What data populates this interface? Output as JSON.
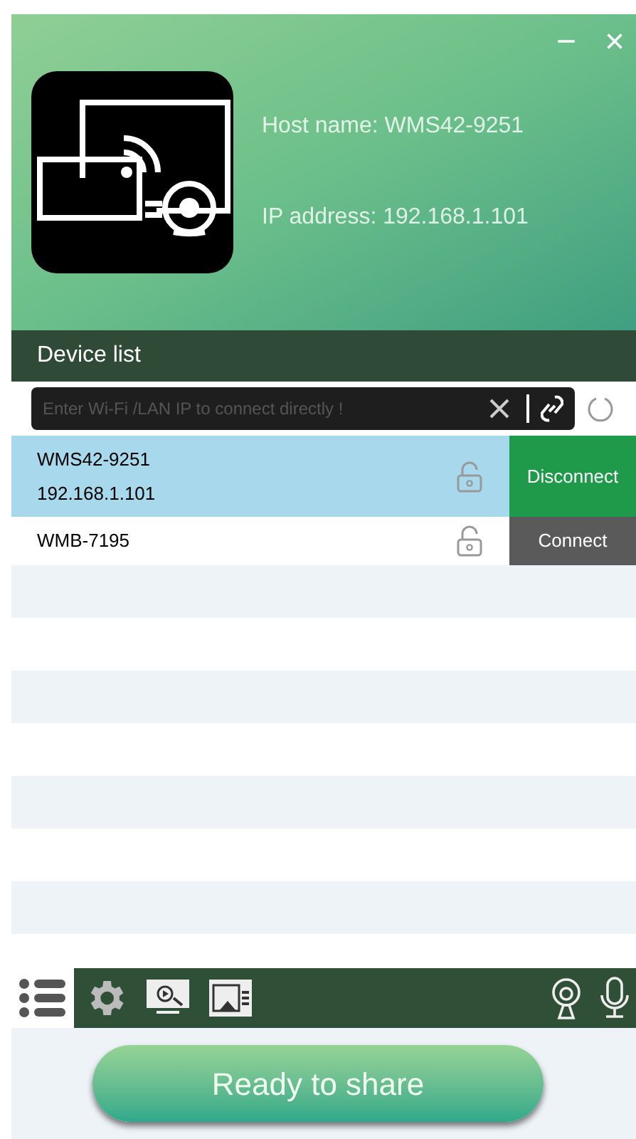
{
  "window": {
    "minimize": "−",
    "close": "×"
  },
  "host": {
    "name_label": "Host name: WMS42-9251",
    "ip_label": "IP address: 192.168.1.101"
  },
  "device_list": {
    "title": "Device list",
    "search": {
      "placeholder": "Enter Wi-Fi /LAN IP to connect directly !"
    },
    "devices": [
      {
        "name": "WMS42-9251",
        "ip": "192.168.1.101",
        "selected": true,
        "connected": true,
        "button": "Disconnect"
      },
      {
        "name": "WMB-7195",
        "selected": false,
        "connected": false,
        "button": "Connect"
      }
    ]
  },
  "toolbar": [
    {
      "kind": "list",
      "selected": true
    },
    {
      "kind": "settings",
      "selected": false
    },
    {
      "kind": "screen",
      "selected": false
    },
    {
      "kind": "cast",
      "selected": false
    }
  ],
  "status_button": "Ready to share"
}
